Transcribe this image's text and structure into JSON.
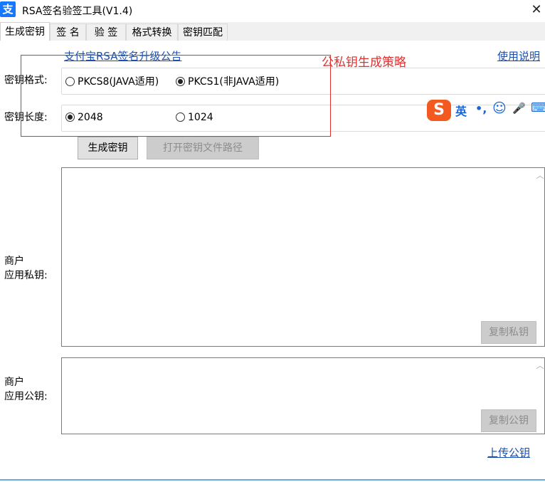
{
  "window": {
    "app_icon_text": "支",
    "title": "RSA签名验签工具(V1.4)",
    "close_symbol": "✕"
  },
  "tabs": [
    {
      "label": "生成密钥"
    },
    {
      "label": "签 名"
    },
    {
      "label": "验 签"
    },
    {
      "label": "格式转换"
    },
    {
      "label": "密钥匹配"
    }
  ],
  "links": {
    "announcement": "支付宝RSA签名升级公告",
    "help": "使用说明",
    "upload_public_key": "上传公钥"
  },
  "annotation": {
    "text": "公私钥生成策略",
    "color": "#e03030"
  },
  "key_format": {
    "label": "密钥格式:",
    "options": [
      {
        "label": "PKCS8(JAVA适用)",
        "checked": false
      },
      {
        "label": "PKCS1(非JAVA适用)",
        "checked": true
      }
    ]
  },
  "key_length": {
    "label": "密钥长度:",
    "options": [
      {
        "label": "2048",
        "checked": true
      },
      {
        "label": "1024",
        "checked": false
      }
    ]
  },
  "buttons": {
    "generate": "生成密钥",
    "open_path": "打开密钥文件路径",
    "copy_private": "复制私钥",
    "copy_public": "复制公钥"
  },
  "private_key": {
    "label_line1": "商户",
    "label_line2": "应用私钥:",
    "value": ""
  },
  "public_key": {
    "label_line1": "商户",
    "label_line2": "应用公钥:",
    "value": ""
  },
  "ime": {
    "logo": "S",
    "mode": "英",
    "punct": "•,",
    "emoji": "☺",
    "mic": "🎤",
    "keyboard": "⌨"
  },
  "colors": {
    "link": "#1a4fb0",
    "annotation": "#e03030",
    "ime_brand": "#f25a1f",
    "ime_icons": "#1a66d6"
  }
}
